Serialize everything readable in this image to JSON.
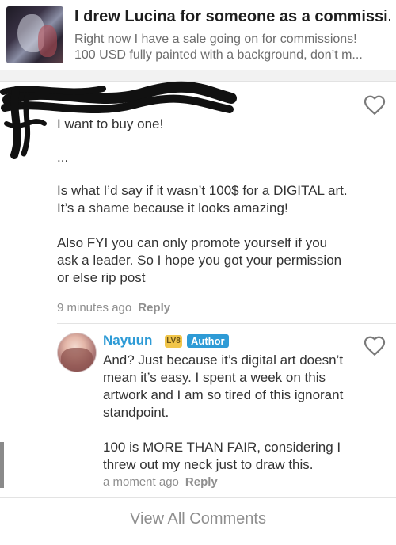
{
  "post": {
    "title": "I drew Lucina for someone as a commissi...",
    "snippet_line1": "Right now I have a sale going on for commissions!",
    "snippet_line2": "100 USD fully painted with a background, don’t m..."
  },
  "comments": [
    {
      "paragraphs": [
        "I want to buy one!",
        "...",
        "Is what I’d say if it wasn’t 100$ for a DIGITAL art. It’s a shame because it looks amazing!",
        "Also FYI you can only promote yourself if you ask a leader. So I hope you got your permission or else rip post"
      ],
      "time": "9 minutes ago",
      "reply_label": "Reply"
    },
    {
      "author": "Nayuun",
      "level_badge": "LV8",
      "author_badge": "Author",
      "paragraphs": [
        "And? Just because it’s digital art doesn’t mean it’s easy. I spent a week on this artwork and I am so tired of this ignorant standpoint.",
        "100 is MORE THAN FAIR, considering I threw out my neck just to draw this."
      ],
      "time": "a moment ago",
      "reply_label": "Reply"
    }
  ],
  "view_all_label": "View All Comments",
  "colors": {
    "accent": "#2e9bd6",
    "level_badge": "#f1c54a",
    "meta_text": "#8f8f8f"
  },
  "icons": [
    "heart-outline-icon",
    "post-thumbnail-image",
    "user-avatar"
  ]
}
